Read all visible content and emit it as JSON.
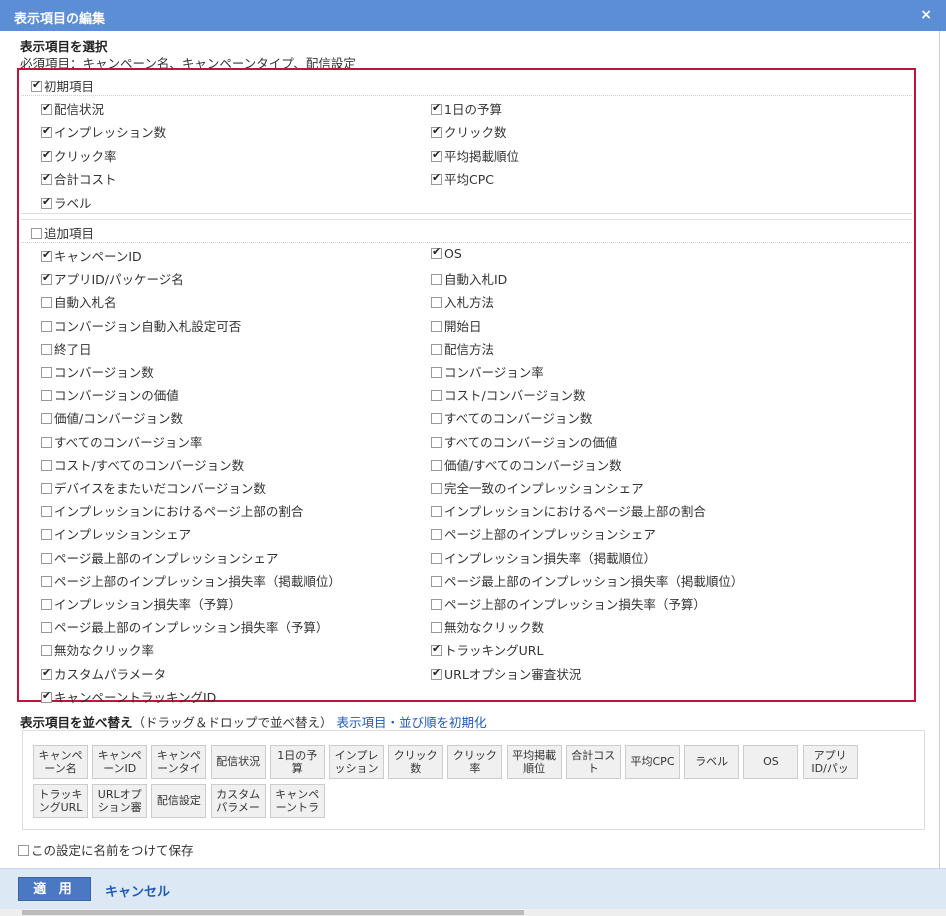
{
  "dialog": {
    "title": "表示項目の編集",
    "close_label": "×"
  },
  "select": {
    "heading": "表示項目を選択",
    "required_note": "必須項目：キャンペーン名、キャンペーンタイプ、配信設定"
  },
  "initial": {
    "label": "初期項目",
    "checked": true,
    "left": [
      {
        "label": "配信状況",
        "checked": true
      },
      {
        "label": "インプレッション数",
        "checked": true
      },
      {
        "label": "クリック率",
        "checked": true
      },
      {
        "label": "合計コスト",
        "checked": true
      },
      {
        "label": "ラベル",
        "checked": true
      }
    ],
    "right": [
      {
        "label": "1日の予算",
        "checked": true
      },
      {
        "label": "クリック数",
        "checked": true
      },
      {
        "label": "平均掲載順位",
        "checked": true
      },
      {
        "label": "平均CPC",
        "checked": true
      }
    ]
  },
  "additional": {
    "label": "追加項目",
    "checked": false,
    "left": [
      {
        "label": "キャンペーンID",
        "checked": true
      },
      {
        "label": "アプリID/パッケージ名",
        "checked": true
      },
      {
        "label": "自動入札名",
        "checked": false
      },
      {
        "label": "コンバージョン自動入札設定可否",
        "checked": false
      },
      {
        "label": "終了日",
        "checked": false
      },
      {
        "label": "コンバージョン数",
        "checked": false
      },
      {
        "label": "コンバージョンの価値",
        "checked": false
      },
      {
        "label": "価値/コンバージョン数",
        "checked": false
      },
      {
        "label": "すべてのコンバージョン率",
        "checked": false
      },
      {
        "label": "コスト/すべてのコンバージョン数",
        "checked": false
      },
      {
        "label": "デバイスをまたいだコンバージョン数",
        "checked": false
      },
      {
        "label": "インプレッションにおけるページ上部の割合",
        "checked": false
      },
      {
        "label": "インプレッションシェア",
        "checked": false
      },
      {
        "label": "ページ最上部のインプレッションシェア",
        "checked": false
      },
      {
        "label": "ページ上部のインプレッション損失率（掲載順位）",
        "checked": false
      },
      {
        "label": "インプレッション損失率（予算）",
        "checked": false
      },
      {
        "label": "ページ最上部のインプレッション損失率（予算）",
        "checked": false
      },
      {
        "label": "無効なクリック率",
        "checked": false
      },
      {
        "label": "カスタムパラメータ",
        "checked": true
      },
      {
        "label": "キャンペーントラッキングID",
        "checked": true
      }
    ],
    "right": [
      {
        "label": "OS",
        "checked": true
      },
      {
        "label": "自動入札ID",
        "checked": false
      },
      {
        "label": "入札方法",
        "checked": false
      },
      {
        "label": "開始日",
        "checked": false
      },
      {
        "label": "配信方法",
        "checked": false
      },
      {
        "label": "コンバージョン率",
        "checked": false
      },
      {
        "label": "コスト/コンバージョン数",
        "checked": false
      },
      {
        "label": "すべてのコンバージョン数",
        "checked": false
      },
      {
        "label": "すべてのコンバージョンの価値",
        "checked": false
      },
      {
        "label": "価値/すべてのコンバージョン数",
        "checked": false
      },
      {
        "label": "完全一致のインプレッションシェア",
        "checked": false
      },
      {
        "label": "インプレッションにおけるページ最上部の割合",
        "checked": false
      },
      {
        "label": "ページ上部のインプレッションシェア",
        "checked": false
      },
      {
        "label": "インプレッション損失率（掲載順位）",
        "checked": false
      },
      {
        "label": "ページ最上部のインプレッション損失率（掲載順位）",
        "checked": false
      },
      {
        "label": "ページ上部のインプレッション損失率（予算）",
        "checked": false
      },
      {
        "label": "無効なクリック数",
        "checked": false
      },
      {
        "label": "トラッキングURL",
        "checked": true
      },
      {
        "label": "URLオプション審査状況",
        "checked": true
      }
    ]
  },
  "order": {
    "heading": "表示項目を並べ替え",
    "hint": "（ドラッグ＆ドロップで並べ替え）",
    "reset_link": "表示項目・並び順を初期化",
    "chips_row1": [
      [
        "キャンペ",
        "ーン名"
      ],
      [
        "キャンペ",
        "ーンID"
      ],
      [
        "キャンペ",
        "ーンタイ"
      ],
      [
        "配信状況",
        ""
      ],
      [
        "1日の予",
        "算"
      ],
      [
        "インプレ",
        "ッション"
      ],
      [
        "クリック",
        "数"
      ],
      [
        "クリック",
        "率"
      ],
      [
        "平均掲載",
        "順位"
      ],
      [
        "合計コス",
        "ト"
      ],
      [
        "平均CPC",
        ""
      ],
      [
        "ラベル",
        ""
      ],
      [
        "OS",
        ""
      ],
      [
        "アプリ",
        "ID/パッ"
      ]
    ],
    "chips_row2": [
      [
        "トラッキ",
        "ングURL"
      ],
      [
        "URLオプ",
        "ション審"
      ],
      [
        "配信設定",
        ""
      ],
      [
        "カスタム",
        "パラメー"
      ],
      [
        "キャンペ",
        "ーントラ"
      ]
    ]
  },
  "save_setting": {
    "label": "この設定に名前をつけて保存",
    "checked": false
  },
  "footer": {
    "apply_label": "適 用",
    "cancel_label": "キャンセル"
  }
}
